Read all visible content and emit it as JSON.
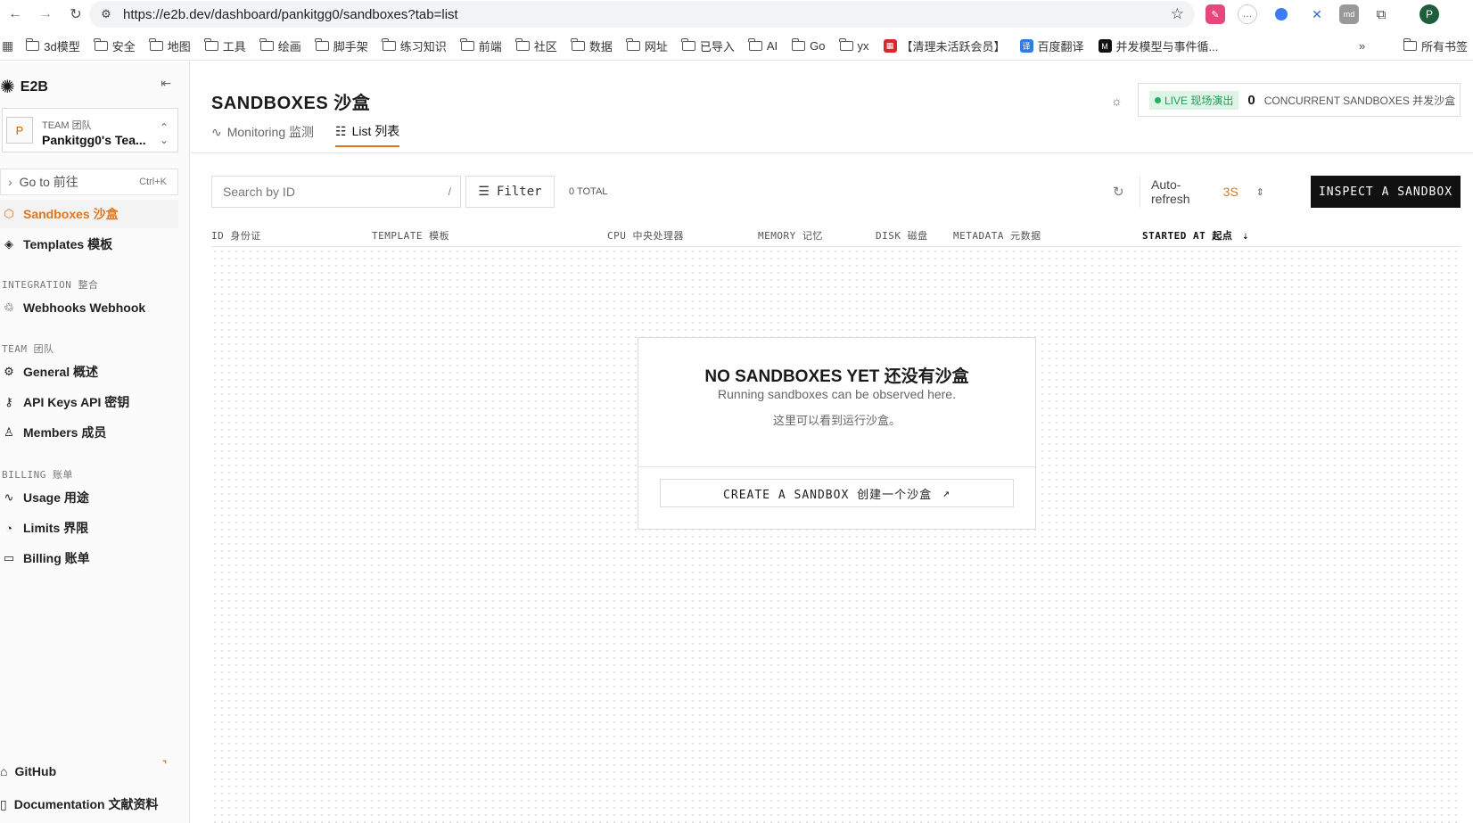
{
  "browser": {
    "url": "https://e2b.dev/dashboard/pankitgg0/sandboxes?tab=list",
    "bookmarks": [
      "3d模型",
      "安全",
      "地图",
      "工具",
      "绘画",
      "脚手架",
      "练习知识",
      "前端",
      "社区",
      "数据",
      "网址",
      "已导入",
      "AI",
      "Go",
      "yx",
      "【清理未活跃会员】",
      "百度翻译",
      "并发模型与事件循...",
      "所有书签"
    ],
    "profile_initial": "P"
  },
  "sidebar": {
    "brand": "E2B",
    "team": {
      "label": "TEAM  团队",
      "name": "Pankitgg0's Tea...",
      "initial": "P"
    },
    "goto": {
      "label": "Go to  前往",
      "shortcut": "Ctrl+K"
    },
    "items": [
      {
        "label": "Sandboxes 沙盒",
        "icon": "cube-icon",
        "active": true
      },
      {
        "label": "Templates 模板",
        "icon": "box-icon"
      }
    ],
    "integration_label": "INTEGRATION  整合",
    "integration_items": [
      {
        "label": "Webhooks Webhook",
        "icon": "webhook-icon"
      }
    ],
    "team_label": "TEAM  团队",
    "team_items": [
      {
        "label": "General 概述",
        "icon": "gear-icon"
      },
      {
        "label": "API Keys API 密钥",
        "icon": "key-icon"
      },
      {
        "label": "Members 成员",
        "icon": "user-icon"
      }
    ],
    "billing_label": "BILLING  账单",
    "billing_items": [
      {
        "label": "Usage 用途",
        "icon": "activity-icon"
      },
      {
        "label": "Limits 界限",
        "icon": "gauge-icon"
      },
      {
        "label": "Billing 账单",
        "icon": "card-icon"
      }
    ],
    "footer": [
      {
        "label": "GitHub",
        "icon": "github-icon"
      },
      {
        "label": "Documentation  文献资料",
        "icon": "book-icon"
      }
    ]
  },
  "header": {
    "title": "SANDBOXES  沙盒",
    "live_label": "LIVE  现场演出",
    "concurrent_count": "0",
    "concurrent_label": "CONCURRENT SANDBOXES  并发沙盒"
  },
  "tabs": [
    {
      "label": "Monitoring   监测",
      "active": false
    },
    {
      "label": "List   列表",
      "active": true
    }
  ],
  "toolbar": {
    "search_placeholder": "Search by ID",
    "search_shortcut": "/",
    "filter_label": "Filter",
    "total": "0 TOTAL",
    "autorefresh_label": "Auto-refresh",
    "autorefresh_value": "3S",
    "inspect_label": "INSPECT A SANDBOX"
  },
  "table": {
    "columns": [
      "ID  身份证",
      "TEMPLATE  模板",
      "CPU  中央处理器",
      "MEMORY  记忆",
      "DISK  磁盘",
      "METADATA  元数据",
      "STARTED AT  起点"
    ]
  },
  "empty_state": {
    "title": "NO SANDBOXES YET  还没有沙盒",
    "subtitle": "Running sandboxes can be observed here.",
    "subtitle_cn": "这里可以看到运行沙盒。",
    "create_label": "CREATE A SANDBOX   创建一个沙盒"
  },
  "colors": {
    "accent": "#e0761a",
    "live_green": "#22b25e",
    "dark": "#111111"
  }
}
